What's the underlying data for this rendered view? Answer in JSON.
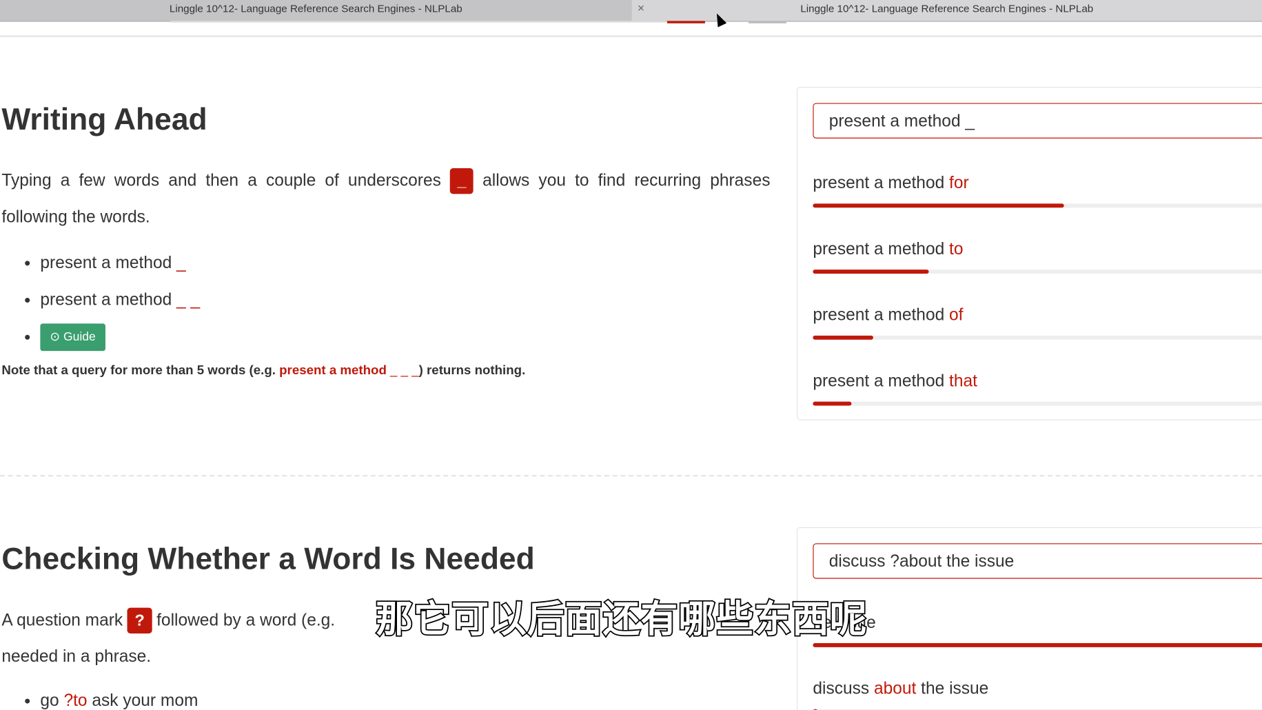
{
  "tabs": [
    {
      "title": "Linggle 10^12- Language Reference Search Engines - NLPLab"
    },
    {
      "title": "Linggle 10^12- Language Reference Search Engines - NLPLab"
    }
  ],
  "tab_close": "×",
  "section1": {
    "title": "Writing Ahead",
    "para_a": "Typing a few words and then a couple of underscores",
    "chip": "_",
    "para_b": "allows you to find recurring phrases following the words.",
    "examples": [
      {
        "text": "present a method",
        "red": "_"
      },
      {
        "text": "present a method",
        "red": "_ _"
      }
    ],
    "guide_label": "Guide",
    "note_a": "Note that a query for more than 5 words (e.g.",
    "note_red": "present a method",
    "note_under": "_ _ _",
    "note_b": ") returns nothing.",
    "query": "present a method _",
    "results": [
      {
        "prefix": "present a method",
        "word": "for",
        "suffix": "",
        "share_pct": 52
      },
      {
        "prefix": "present a method",
        "word": "to",
        "suffix": "",
        "share_pct": 24
      },
      {
        "prefix": "present a method",
        "word": "of",
        "suffix": "",
        "share_pct": 12.5
      },
      {
        "prefix": "present a method",
        "word": "that",
        "suffix": "",
        "share_pct": 8
      }
    ]
  },
  "section2": {
    "title": "Checking Whether a Word Is Needed",
    "para_a": "A question mark",
    "chip": "?",
    "para_b": "followed by a word (e.g.",
    "para_c": "needed in a phrase.",
    "examples": [
      {
        "a": "go",
        "red": "?to",
        "b": "ask your mom"
      }
    ],
    "query": "discuss ?about the issue",
    "results": [
      {
        "prefix": "",
        "word": "",
        "suffix": "he issue",
        "share_pct": 100
      },
      {
        "prefix": "discuss",
        "word": "about",
        "suffix": "the issue",
        "share_pct": 1
      }
    ]
  },
  "subtitle": "那它可以后面还有哪些东西呢",
  "colors": {
    "accent": "#c0190b",
    "guide": "#3a9e6e"
  }
}
